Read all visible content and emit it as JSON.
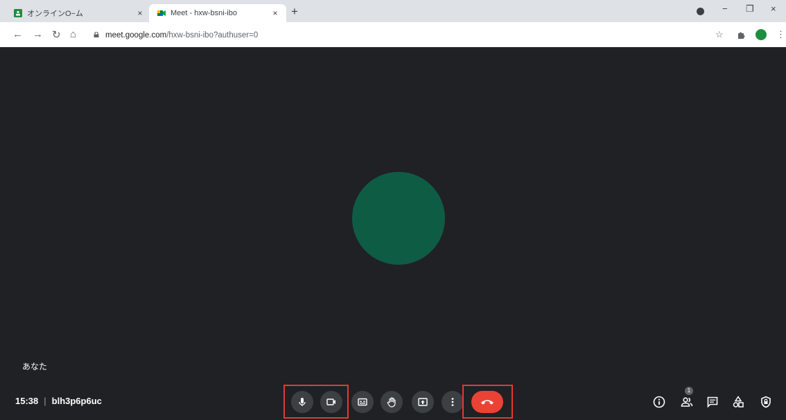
{
  "browser": {
    "tabs": [
      {
        "title": "オンラインO−ム",
        "close": "×"
      },
      {
        "title": "Meet - hxw-bsni-ibo",
        "close": "×"
      }
    ],
    "new_tab": "+",
    "url_host": "meet.google.com",
    "url_path": "/hxw-bsni-ibo?authuser=0",
    "window_controls": {
      "minimize": "−",
      "restore": "❐",
      "close": "×"
    }
  },
  "meeting": {
    "self_label": "あなた",
    "time": "15:38",
    "separator": "|",
    "code": "blh3p6p6uc",
    "participant_count": "1"
  },
  "colors": {
    "background": "#202124",
    "avatar": "#0f5c45",
    "hangup": "#ea4335",
    "highlight": "#e53935"
  },
  "controls": [
    "mic-icon",
    "camera-icon",
    "captions-icon",
    "raise-hand-icon",
    "present-icon",
    "more-options-icon",
    "hangup-icon"
  ],
  "side_controls": [
    "info-icon",
    "people-icon",
    "chat-icon",
    "activities-icon",
    "host-controls-icon"
  ]
}
